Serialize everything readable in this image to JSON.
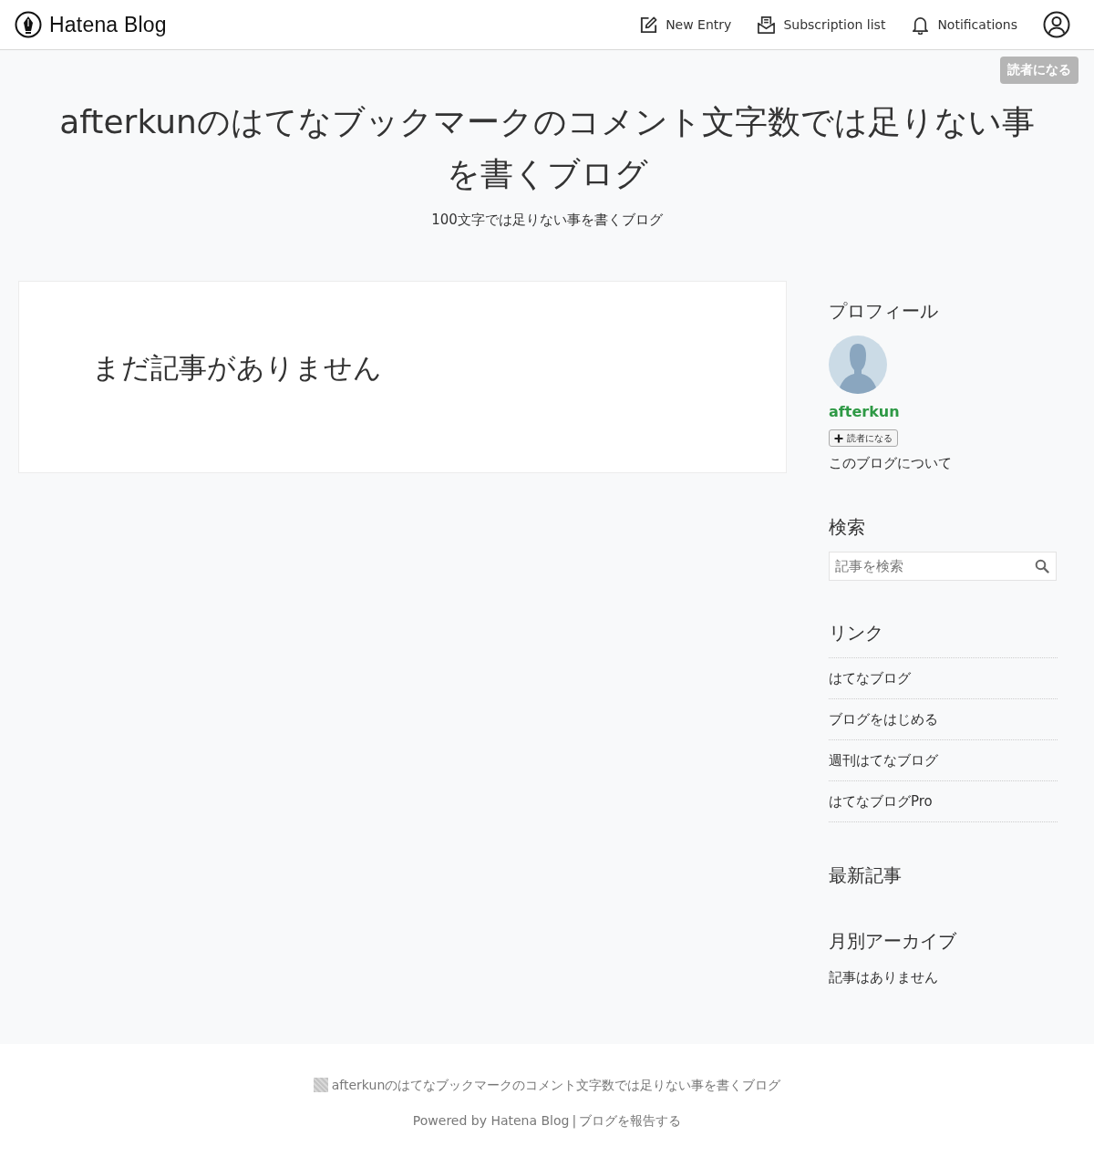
{
  "header": {
    "logo": "Hatena Blog",
    "nav": [
      {
        "kind": "edit",
        "label": "New Entry"
      },
      {
        "kind": "inbox",
        "label": "Subscription list"
      },
      {
        "kind": "bell",
        "label": "Notifications"
      }
    ]
  },
  "subscribe_button": "読者になる",
  "blog": {
    "title": "afterkunのはてなブックマークのコメント文字数では足りない事を書くブログ",
    "description": "100文字では足りない事を書くブログ"
  },
  "main": {
    "empty_message": "まだ記事がありません"
  },
  "sidebar": {
    "profile": {
      "heading": "プロフィール",
      "name": "afterkun",
      "subscribe": "読者になる",
      "about": "このブログについて"
    },
    "search": {
      "heading": "検索",
      "placeholder": "記事を検索"
    },
    "links": {
      "heading": "リンク",
      "items": [
        "はてなブログ",
        "ブログをはじめる",
        "週刊はてなブログ",
        "はてなブログPro"
      ]
    },
    "recent": {
      "heading": "最新記事"
    },
    "archive": {
      "heading": "月別アーカイブ",
      "empty": "記事はありません"
    }
  },
  "footer": {
    "blog_title": "afterkunのはてなブックマークのコメント文字数では足りない事を書くブログ",
    "powered_by": "Powered by Hatena Blog",
    "separator": "|",
    "report": "ブログを報告する"
  }
}
